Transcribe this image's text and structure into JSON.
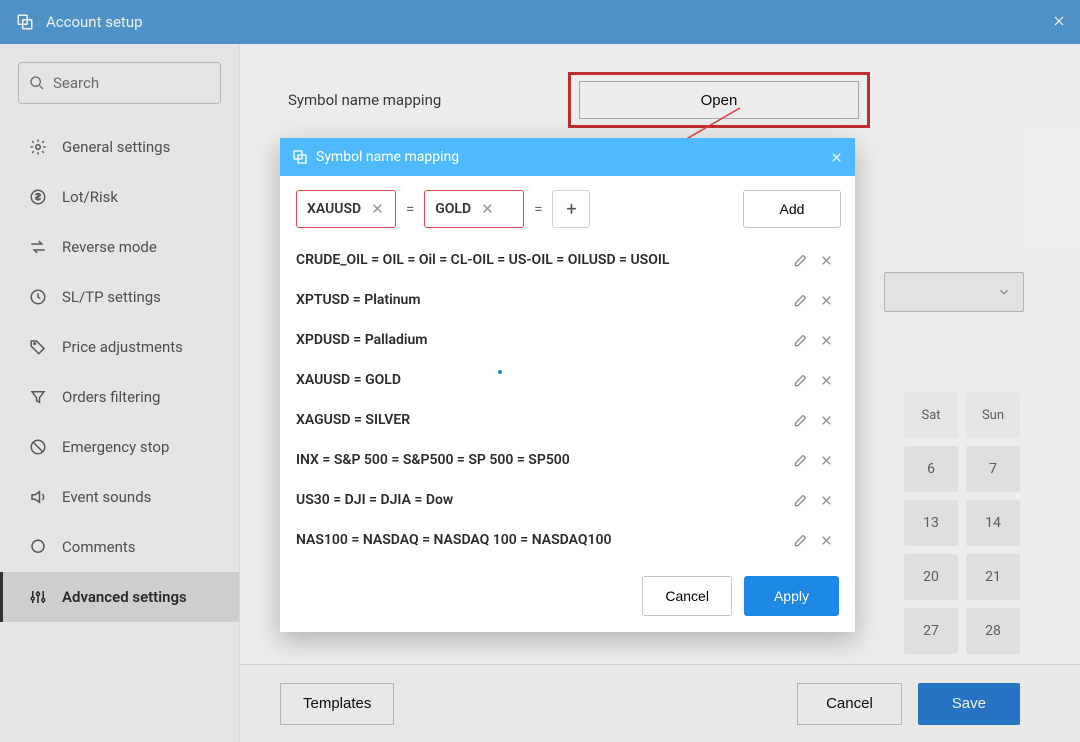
{
  "topbar": {
    "title": "Account setup"
  },
  "search": {
    "placeholder": "Search"
  },
  "sidebar": {
    "items": [
      {
        "label": "General settings",
        "icon": "gear-icon"
      },
      {
        "label": "Lot/Risk",
        "icon": "dollar-circle-icon"
      },
      {
        "label": "Reverse mode",
        "icon": "swap-icon"
      },
      {
        "label": "SL/TP settings",
        "icon": "clock-icon"
      },
      {
        "label": "Price adjustments",
        "icon": "tag-icon"
      },
      {
        "label": "Orders filtering",
        "icon": "filter-icon"
      },
      {
        "label": "Emergency stop",
        "icon": "stop-icon"
      },
      {
        "label": "Event sounds",
        "icon": "speaker-icon"
      },
      {
        "label": "Comments",
        "icon": "chat-icon"
      },
      {
        "label": "Advanced settings",
        "icon": "sliders-icon",
        "active": true
      }
    ]
  },
  "section": {
    "label": "Symbol name mapping",
    "open_button": "Open"
  },
  "modal": {
    "title": "Symbol name mapping",
    "tag1": "XAUUSD",
    "tag2": "GOLD",
    "add": "Add",
    "rows": [
      "CRUDE_OIL = OIL = Oil = CL-OIL = US-OIL = OILUSD = USOIL",
      "XPTUSD = Platinum",
      "XPDUSD = Palladium",
      "XAUUSD = GOLD",
      "XAGUSD = SILVER",
      "INX = S&P 500 = S&P500 = SP 500 = SP500",
      "US30 = DJI = DJIA = Dow",
      "NAS100 = NASDAQ = NASDAQ 100 = NASDAQ100"
    ],
    "cancel": "Cancel",
    "apply": "Apply"
  },
  "footer": {
    "templates": "Templates",
    "cancel": "Cancel",
    "save": "Save"
  },
  "calendar": {
    "headers": [
      "Sat",
      "Sun"
    ],
    "cells": [
      [
        "6",
        "7"
      ],
      [
        "13",
        "14"
      ],
      [
        "20",
        "21"
      ],
      [
        "27",
        "28"
      ]
    ]
  }
}
